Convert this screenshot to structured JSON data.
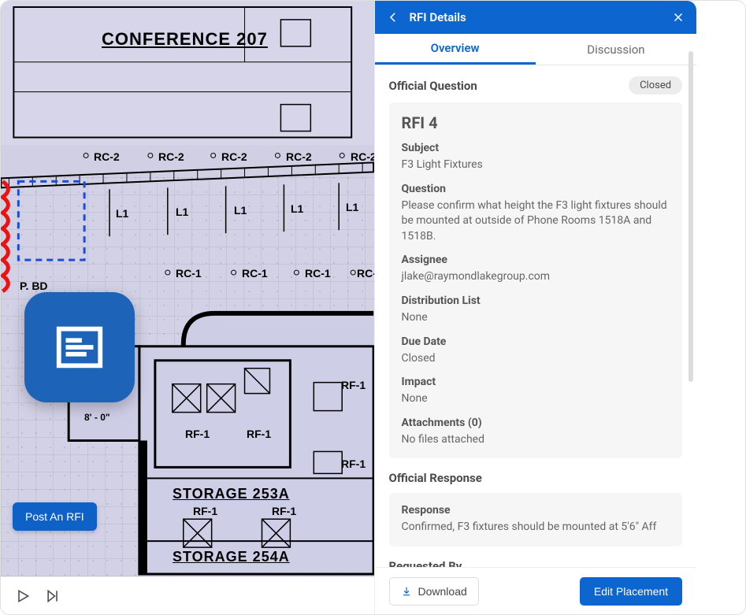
{
  "drawing": {
    "rooms": {
      "conference": "CONFERENCE  207",
      "storage_a": "STORAGE  253A",
      "storage_b": "STORAGE  254A"
    },
    "tags": {
      "rc2": "RC-2",
      "rc1": "RC-1",
      "l1": "L1",
      "rf1": "RF-1",
      "pbd": "P. BD",
      "dim": "8' - 0\""
    },
    "post_rfi_button": "Post An RFI"
  },
  "panel": {
    "header_title": "RFI Details",
    "tabs": {
      "overview": "Overview",
      "discussion": "Discussion"
    },
    "official_question_label": "Official Question",
    "status_badge": "Closed",
    "rfi_title": "RFI 4",
    "fields": {
      "subject_label": "Subject",
      "subject_value": "F3 Light Fixtures",
      "question_label": "Question",
      "question_value": "Please confirm what height the F3 light fixtures should be mounted at outside of Phone Rooms 1518A and 1518B.",
      "assignee_label": "Assignee",
      "assignee_value": "jlake@raymondlakegroup.com",
      "distribution_label": "Distribution List",
      "distribution_value": "None",
      "duedate_label": "Due Date",
      "duedate_value": "Closed",
      "impact_label": "Impact",
      "impact_value": "None",
      "attachments_label": "Attachments (0)",
      "attachments_value": "No files attached"
    },
    "official_response_label": "Official Response",
    "response_label": "Response",
    "response_value": "Confirmed, F3 fixtures should be mounted at 5'6\" Aff",
    "requested_by_label": "Requested By",
    "footer": {
      "download": "Download",
      "edit": "Edit Placement"
    }
  }
}
